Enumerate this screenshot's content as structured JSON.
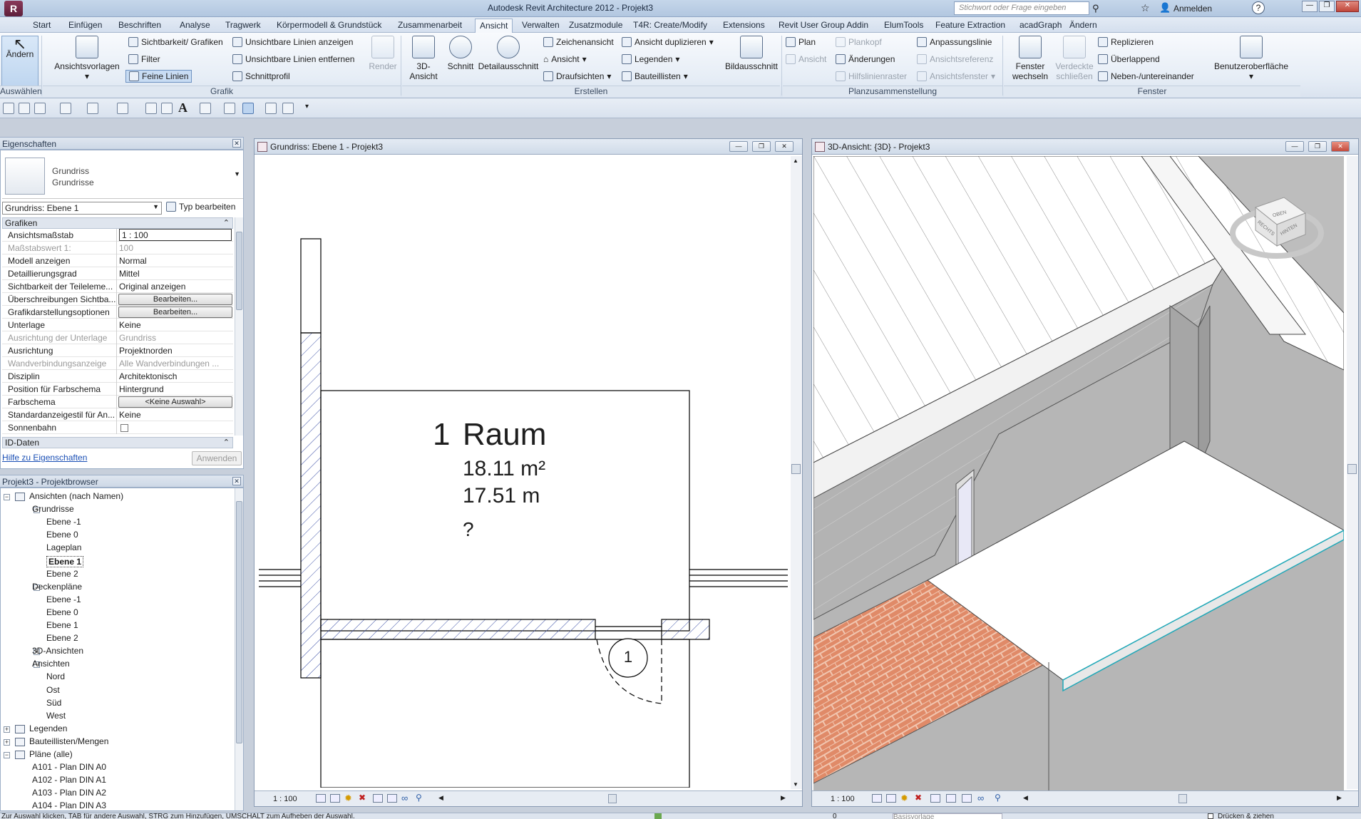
{
  "title": "Autodesk Revit Architecture 2012 -    Projekt3",
  "search_placeholder": "Stichwort oder Frage eingeben",
  "signin": "Anmelden",
  "menu_tabs": [
    "Start",
    "Einfügen",
    "Beschriften",
    "Analyse",
    "Tragwerk",
    "Körpermodell & Grundstück",
    "Zusammenarbeit",
    "Ansicht",
    "Verwalten",
    "Zusatzmodule",
    "T4R: Create/Modify",
    "Extensions",
    "Revit User Group Addin",
    "ElumTools",
    "Feature Extraction",
    "acadGraph",
    "Ändern"
  ],
  "active_tab": "Ansicht",
  "ribbon": {
    "modify": "Ändern",
    "view_templates": "Ansichtsvorlagen",
    "visibility": "Sichtbarkeit/ Grafiken",
    "filter": "Filter",
    "thin_lines": "Feine Linien",
    "show_hidden": "Unsichtbare Linien anzeigen",
    "remove_hidden": "Unsichtbare Linien entfernen",
    "section_profile": "Schnittprofil",
    "render": "Render",
    "view3d": "3D-\nAnsicht",
    "section": "Schnitt",
    "callout": "Detailausschnitt",
    "drafting": "Zeichenansicht",
    "elevation": "Ansicht",
    "plan_views": "Draufsichten",
    "duplicate": "Ansicht duplizieren",
    "legends": "Legenden",
    "schedules": "Bauteillisten",
    "scope_box": "Bildausschnitt",
    "sheet": "Plan",
    "titleblock": "Plankopf",
    "view_btn": "Ansicht",
    "revisions": "Änderungen",
    "guide_grid": "Hilfslinienraster",
    "matchline": "Anpassungslinie",
    "view_ref": "Ansichtsreferenz",
    "viewports": "Ansichtsfenster",
    "switch_windows": "Fenster\nwechseln",
    "close_hidden": "Verdeckte\nschließen",
    "replicate": "Replizieren",
    "cascade": "Überlappend",
    "tile": "Neben-/untereinander",
    "ui": "Benutzeroberfläche",
    "groups": {
      "select": "Auswählen",
      "graphics": "Grafik",
      "create": "Erstellen",
      "sheet_comp": "Planzusammenstellung",
      "windows": "Fenster"
    }
  },
  "properties": {
    "title": "Eigenschaften",
    "type_line1": "Grundriss",
    "type_line2": "Grundrisse",
    "instance_select": "Grundriss: Ebene 1",
    "edit_type": "Typ bearbeiten",
    "section": "Grafiken",
    "rows": [
      {
        "name": "Ansichtsmaßstab",
        "value": "1 : 100"
      },
      {
        "name": "Maßstabswert 1:",
        "value": "100",
        "gray": true
      },
      {
        "name": "Modell anzeigen",
        "value": "Normal"
      },
      {
        "name": "Detaillierungsgrad",
        "value": "Mittel"
      },
      {
        "name": "Sichtbarkeit der Teileleme...",
        "value": "Original anzeigen"
      },
      {
        "name": "Überschreibungen Sichtba...",
        "value": "Bearbeiten...",
        "button": true
      },
      {
        "name": "Grafikdarstellungsoptionen",
        "value": "Bearbeiten...",
        "button": true
      },
      {
        "name": "Unterlage",
        "value": "Keine"
      },
      {
        "name": "Ausrichtung der Unterlage",
        "value": "Grundriss",
        "gray": true
      },
      {
        "name": "Ausrichtung",
        "value": "Projektnorden"
      },
      {
        "name": "Wandverbindungsanzeige",
        "value": "Alle Wandverbindungen ...",
        "gray": true
      },
      {
        "name": "Disziplin",
        "value": "Architektonisch"
      },
      {
        "name": "Position für Farbschema",
        "value": "Hintergrund"
      },
      {
        "name": "Farbschema",
        "value": "<Keine Auswahl>",
        "button": true
      },
      {
        "name": "Standardanzeigestil für An...",
        "value": "Keine"
      },
      {
        "name": "Sonnenbahn",
        "value": ""
      }
    ],
    "id_section": "ID-Daten",
    "help_link": "Hilfe zu Eigenschaften",
    "apply": "Anwenden"
  },
  "browser": {
    "title": "Projekt3 - Projektbrowser",
    "items": [
      {
        "label": "Ansichten (nach Namen)",
        "level": 0,
        "exp": "-"
      },
      {
        "label": "Grundrisse",
        "level": 1,
        "exp": "-"
      },
      {
        "label": "Ebene -1",
        "level": 2
      },
      {
        "label": "Ebene 0",
        "level": 2
      },
      {
        "label": "Lageplan",
        "level": 2
      },
      {
        "label": "Ebene 1",
        "level": 2,
        "bold": true
      },
      {
        "label": "Ebene 2",
        "level": 2
      },
      {
        "label": "Deckenpläne",
        "level": 1,
        "exp": "-"
      },
      {
        "label": "Ebene -1",
        "level": 2
      },
      {
        "label": "Ebene 0",
        "level": 2
      },
      {
        "label": "Ebene 1",
        "level": 2
      },
      {
        "label": "Ebene 2",
        "level": 2
      },
      {
        "label": "3D-Ansichten",
        "level": 1,
        "exp": "+"
      },
      {
        "label": "Ansichten",
        "level": 1,
        "exp": "-"
      },
      {
        "label": "Nord",
        "level": 2
      },
      {
        "label": "Ost",
        "level": 2
      },
      {
        "label": "Süd",
        "level": 2
      },
      {
        "label": "West",
        "level": 2
      },
      {
        "label": "Legenden",
        "level": 0,
        "exp": "+"
      },
      {
        "label": "Bauteillisten/Mengen",
        "level": 0,
        "exp": "+"
      },
      {
        "label": "Pläne (alle)",
        "level": 0,
        "exp": "-"
      },
      {
        "label": "A101 - Plan DIN A0",
        "level": 1
      },
      {
        "label": "A102 - Plan DIN A1",
        "level": 1
      },
      {
        "label": "A103 - Plan DIN A2",
        "level": 1
      },
      {
        "label": "A104 - Plan DIN A3",
        "level": 1
      }
    ]
  },
  "plan_view": {
    "title": "Grundriss: Ebene 1 - Projekt3",
    "room_number": "1",
    "room_name": "Raum",
    "area": "18.11 m²",
    "perimeter": "17.51 m",
    "unknown": "?",
    "door_tag": "1",
    "scale": "1 : 100"
  },
  "view3d": {
    "title": "3D-Ansicht: {3D} - Projekt3",
    "scale": "1 : 100",
    "cube_labels": [
      "OBEN",
      "RECHTS",
      "HINTEN"
    ]
  },
  "status": "Zur Auswahl klicken, TAB für andere Auswahl, STRG zum Hinzufügen, UMSCHALT zum Aufheben der Auswahl.",
  "status_right": {
    "zero": "0",
    "base": "Basisvorlage",
    "press_drag": "Drücken & ziehen"
  }
}
